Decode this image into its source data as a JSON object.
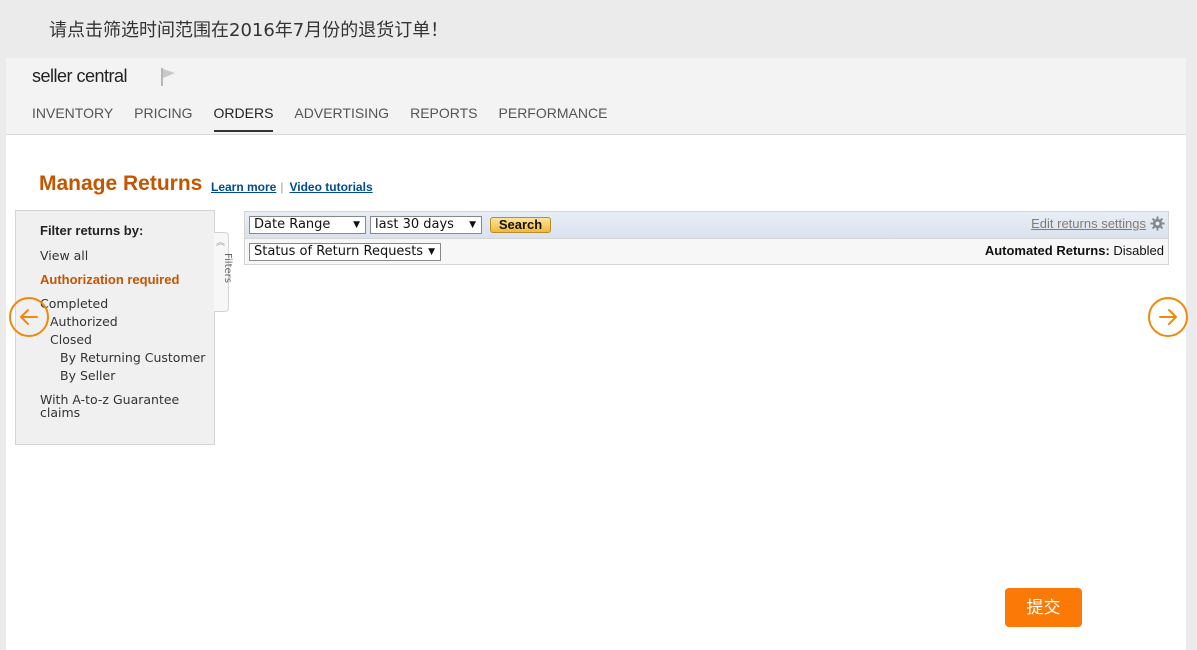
{
  "instruction": "请点击筛选时间范围在2016年7月份的退货订单！",
  "header": {
    "logo": "seller central",
    "nav": [
      "INVENTORY",
      "PRICING",
      "ORDERS",
      "ADVERTISING",
      "REPORTS",
      "PERFORMANCE"
    ],
    "active_nav": "ORDERS"
  },
  "page": {
    "title": "Manage Returns",
    "learn_more": "Learn more",
    "separator": "|",
    "video_tutorials": "Video tutorials"
  },
  "sidebar": {
    "header": "Filter returns by:",
    "view_all": "View all",
    "authorization_required": "Authorization required",
    "completed": "Completed",
    "authorized": "Authorized",
    "closed": "Closed",
    "by_returning_customer": "By Returning Customer",
    "by_seller": "By Seller",
    "atoz_line1": "With A-to-z Guarantee",
    "atoz_line2": "claims",
    "filters_tab": "Filters"
  },
  "filters": {
    "date_range": "Date Range",
    "period": "last 30 days",
    "search": "Search",
    "edit_settings": "Edit returns settings",
    "status": "Status of Return Requests",
    "automated_label": "Automated Returns:",
    "automated_value": "Disabled"
  },
  "submit": "提交",
  "colors": {
    "accent": "#c45500",
    "submit": "#fb7a07",
    "arrow": "#f0890b"
  }
}
